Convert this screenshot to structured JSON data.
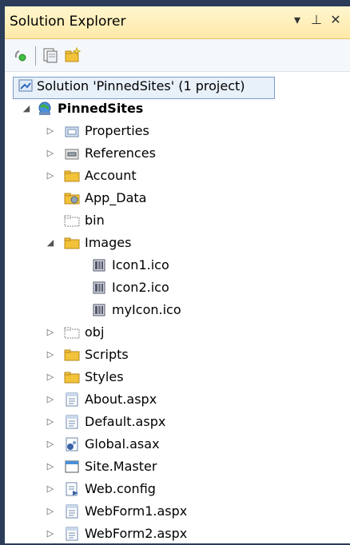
{
  "window": {
    "title": "Solution Explorer",
    "dropdown_glyph": "▾",
    "pin_glyph": "⊥",
    "close_glyph": "✕"
  },
  "toolbar": {
    "btn1_icon": "properties-icon",
    "btn2_icon": "show-all-files-icon",
    "btn3_icon": "refresh-icon"
  },
  "tree": {
    "solution": "Solution 'PinnedSites' (1 project)",
    "project": "PinnedSites",
    "items": [
      {
        "label": "Properties",
        "icon": "properties-folder-icon"
      },
      {
        "label": "References",
        "icon": "references-icon"
      },
      {
        "label": "Account",
        "icon": "folder-icon"
      },
      {
        "label": "App_Data",
        "icon": "app-data-folder-icon"
      },
      {
        "label": "bin",
        "icon": "hidden-folder-icon"
      },
      {
        "label": "Images",
        "icon": "folder-open-icon"
      },
      {
        "label": "Icon1.ico",
        "icon": "ico-file-icon"
      },
      {
        "label": "Icon2.ico",
        "icon": "ico-file-icon"
      },
      {
        "label": "myIcon.ico",
        "icon": "ico-file-icon"
      },
      {
        "label": "obj",
        "icon": "hidden-folder-icon"
      },
      {
        "label": "Scripts",
        "icon": "folder-icon"
      },
      {
        "label": "Styles",
        "icon": "folder-icon"
      },
      {
        "label": "About.aspx",
        "icon": "aspx-file-icon"
      },
      {
        "label": "Default.aspx",
        "icon": "aspx-file-icon"
      },
      {
        "label": "Global.asax",
        "icon": "asax-file-icon"
      },
      {
        "label": "Site.Master",
        "icon": "master-file-icon"
      },
      {
        "label": "Web.config",
        "icon": "config-file-icon"
      },
      {
        "label": "WebForm1.aspx",
        "icon": "aspx-file-icon"
      },
      {
        "label": "WebForm2.aspx",
        "icon": "aspx-file-icon"
      }
    ]
  },
  "colors": {
    "titlebar": "#ffe9a8",
    "frame": "#2b3c59",
    "folder": "#f2c23b",
    "selection_border": "#7a9ccc"
  }
}
